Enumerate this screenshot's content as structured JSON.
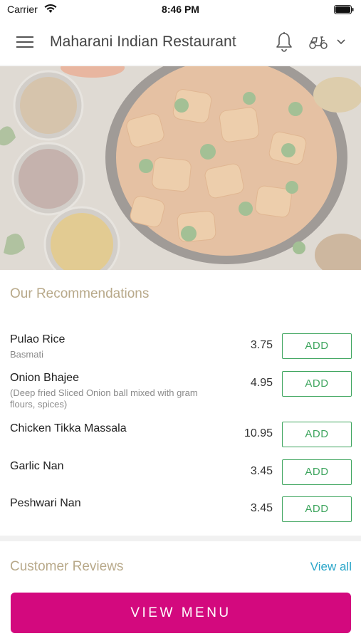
{
  "status_bar": {
    "carrier": "Carrier",
    "time": "8:46 PM"
  },
  "header": {
    "title": "Maharani Indian Restaurant",
    "icons": [
      "menu-icon",
      "bell-icon",
      "delivery-scooter-icon",
      "chevron-down-icon"
    ]
  },
  "recommendations": {
    "title": "Our Recommendations",
    "add_label": "ADD",
    "items": [
      {
        "name": "Pulao Rice",
        "description": "Basmati",
        "price": "3.75"
      },
      {
        "name": "Onion Bhajee",
        "description": "(Deep fried Sliced Onion ball mixed with gram flours, spices)",
        "price": "4.95"
      },
      {
        "name": "Chicken Tikka Massala",
        "description": "",
        "price": "10.95"
      },
      {
        "name": "Garlic Nan",
        "description": "",
        "price": "3.45"
      },
      {
        "name": "Peshwari Nan",
        "description": "",
        "price": "3.45"
      }
    ]
  },
  "reviews": {
    "title": "Customer Reviews",
    "view_all_label": "View all"
  },
  "footer": {
    "view_menu_label": "VIEW MENU"
  },
  "colors": {
    "accent": "#d3097e",
    "add_green": "#3ea55e",
    "link": "#2aa6c9",
    "section_title": "#b8a98a"
  }
}
